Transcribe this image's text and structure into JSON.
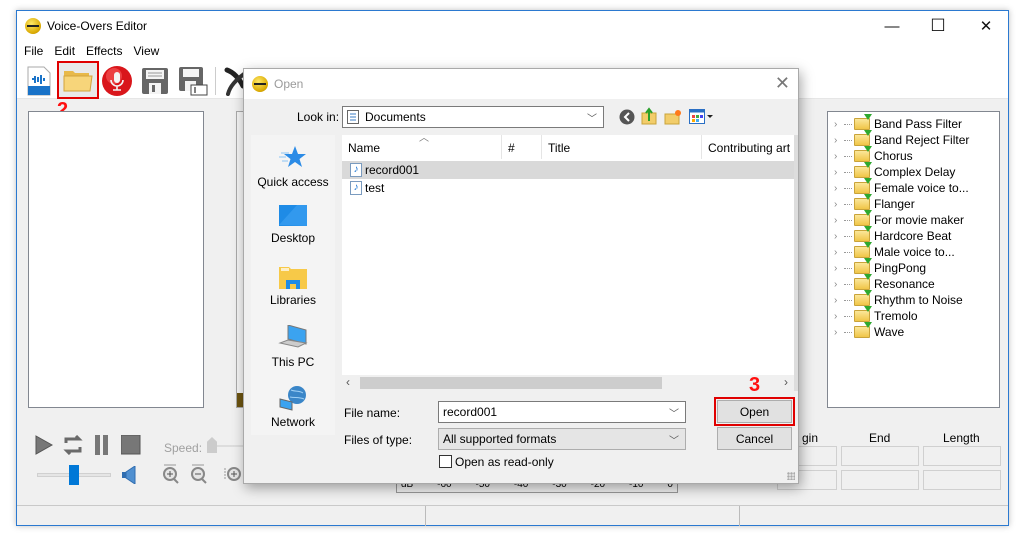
{
  "app": {
    "title": "Voice-Overs Editor",
    "window_controls": {
      "minimize": "—",
      "maximize": "☐",
      "close": "✕"
    },
    "menu": [
      "File",
      "Edit",
      "Effects",
      "View"
    ],
    "toolbar": [
      {
        "name": "new-file",
        "icon": "audio-file-icon"
      },
      {
        "name": "open-file",
        "icon": "folder-open-icon",
        "highlighted": true
      },
      {
        "name": "record",
        "icon": "microphone-icon"
      },
      {
        "name": "save",
        "icon": "floppy-disk-icon"
      },
      {
        "name": "save-as",
        "icon": "floppy-disk-rename-icon"
      },
      {
        "name": "cut",
        "icon": "scissors-icon"
      }
    ],
    "step_labels": {
      "open_toolbar": "2",
      "open_button": "3"
    },
    "effects": [
      "Band Pass Filter",
      "Band Reject Filter",
      "Chorus",
      "Complex Delay",
      "Female voice to...",
      "Flanger",
      "For movie maker",
      "Hardcore Beat",
      "Male voice to...",
      "PingPong",
      "Resonance",
      "Rhythm to Noise",
      "Tremolo",
      "Wave"
    ],
    "transport": {
      "speed_label": "Speed:",
      "volume_fraction": 0.5
    },
    "meter": {
      "ticks": [
        "dB",
        "-60",
        "-50",
        "-40",
        "-30",
        "-20",
        "-10",
        "0"
      ]
    },
    "selection": {
      "headers": [
        "Begin",
        "End",
        "Length"
      ],
      "visible_begin": "gin"
    },
    "colors": {
      "accent": "#0078d7",
      "highlight": "#e00000",
      "window_border": "#2b79d0"
    }
  },
  "dialog": {
    "title": "Open",
    "look_in_label": "Look in:",
    "look_in_value": "Documents",
    "places": [
      "Quick access",
      "Desktop",
      "Libraries",
      "This PC",
      "Network"
    ],
    "columns": [
      "Name",
      "#",
      "Title",
      "Contributing art"
    ],
    "files": [
      {
        "name": "record001",
        "selected": true
      },
      {
        "name": "test",
        "selected": false
      }
    ],
    "file_name_label": "File name:",
    "file_name_value": "record001",
    "file_type_label": "Files of type:",
    "file_type_value": "All supported formats",
    "readonly_label": "Open as read-only",
    "readonly_checked": false,
    "open_button": "Open",
    "cancel_button": "Cancel"
  }
}
